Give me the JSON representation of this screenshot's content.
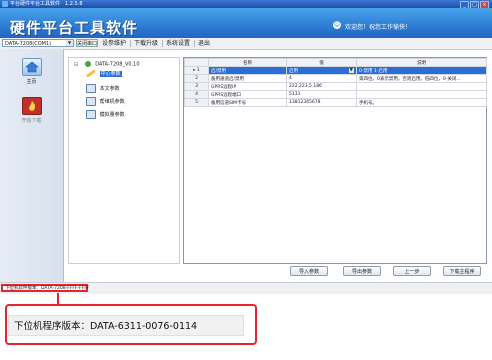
{
  "window": {
    "title": "平台硬件平台工具软件　1.2.5.8",
    "minimize_glyph": "_",
    "maximize_glyph": "□",
    "close_glyph": "×"
  },
  "banner": {
    "logo_text": "硬件平台工具软件",
    "welcome_text": "欢迎您！祝您工作愉快！"
  },
  "toolbar": {
    "device_select_value": "DATA-7208(COM1)",
    "connect_button": "关闭串口",
    "menus": [
      "设参维护",
      "下载升级",
      "系统设置",
      "退出"
    ]
  },
  "sidebar": {
    "items": [
      {
        "label": "主页",
        "icon": "home-icon"
      },
      {
        "label": "开始下载",
        "icon": "fire-download-icon"
      }
    ]
  },
  "tree": {
    "root": "DATA-7208_V0.10",
    "children": [
      "中心参数",
      "本文参数",
      "帮维机参数",
      "模拟量参数"
    ],
    "selected_index": 0
  },
  "grid": {
    "headers": [
      "",
      "名称",
      "值",
      "说明"
    ],
    "rows": [
      {
        "num": "1",
        "name": "启/禁用",
        "value": "启用",
        "desc": "0-禁用 1-启用"
      },
      {
        "num": "2",
        "name": "备用通道启/禁用",
        "value": "4",
        "desc": "第四位，0表示禁用，否则启用。低四位，0-关闭..."
      },
      {
        "num": "3",
        "name": "GPRS远程IP",
        "value": "222.223.5.186",
        "desc": ""
      },
      {
        "num": "4",
        "name": "GPRS远程端口",
        "value": "5131",
        "desc": ""
      },
      {
        "num": "5",
        "name": "备用信道SIM卡号",
        "value": "13812345678",
        "desc": "手机号。"
      }
    ],
    "selected_row": 0
  },
  "buttons": {
    "import": "导入参数",
    "export": "导出参数",
    "prev": "上一步",
    "download": "下载主程序"
  },
  "status": {
    "version_text": "下位机软件版本：DATA-7208-FFFF-FFFF"
  },
  "callout": {
    "text": "下位机程序版本：DATA-6311-0076-0114"
  },
  "colors": {
    "banner_top": "#48a3ec",
    "banner_bottom": "#2366be",
    "highlight_red": "#e8252c",
    "selection_blue": "#2b6fd4"
  }
}
